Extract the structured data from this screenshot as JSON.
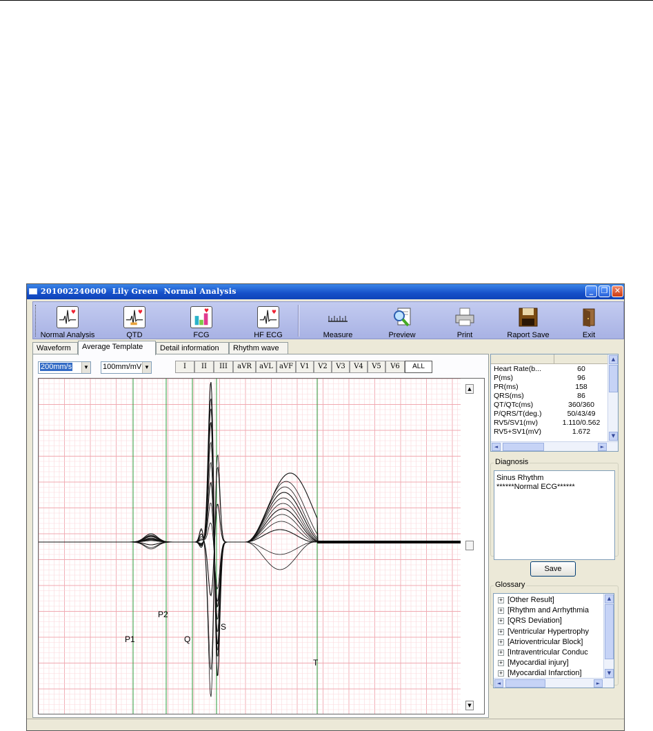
{
  "window": {
    "title": "201002240000  Lily Green  Normal Analysis"
  },
  "toolbar": {
    "items": [
      {
        "label": "Normal Analysis",
        "icon": "ecg-heart-icon"
      },
      {
        "label": "QTD",
        "icon": "ecg-heart-icon"
      },
      {
        "label": "FCG",
        "icon": "fcg-chart-icon"
      },
      {
        "label": "HF ECG",
        "icon": "ecg-heart-icon"
      },
      {
        "label": "Measure",
        "icon": "ruler-icon"
      },
      {
        "label": "Preview",
        "icon": "magnifier-document-icon"
      },
      {
        "label": "Print",
        "icon": "printer-icon"
      },
      {
        "label": "Raport Save",
        "icon": "floppy-disk-icon"
      },
      {
        "label": "Exit",
        "icon": "exit-door-icon"
      }
    ]
  },
  "tabs": [
    "Waveform",
    "Average Template",
    "Detail information",
    "Rhythm wave"
  ],
  "active_tab": "Average Template",
  "controls": {
    "speed": "200mm/s",
    "gain": "100mm/mV",
    "leads": [
      "I",
      "II",
      "III",
      "aVR",
      "aVL",
      "aVF",
      "V1",
      "V2",
      "V3",
      "V4",
      "V5",
      "V6",
      "ALL"
    ],
    "selected_lead": "ALL"
  },
  "markers": [
    "P1",
    "P2",
    "Q",
    "S",
    "T"
  ],
  "parameters": [
    {
      "name": "Heart Rate(b...",
      "value": "60"
    },
    {
      "name": "P(ms)",
      "value": "96"
    },
    {
      "name": "PR(ms)",
      "value": "158"
    },
    {
      "name": "QRS(ms)",
      "value": "86"
    },
    {
      "name": "QT/QTc(ms)",
      "value": "360/360"
    },
    {
      "name": "P/QRS/T(deg.)",
      "value": "50/43/49"
    },
    {
      "name": "RV5/SV1(mv)",
      "value": "1.110/0.562"
    },
    {
      "name": "RV5+SV1(mV)",
      "value": "1.672"
    }
  ],
  "diagnosis": {
    "label": "Diagnosis",
    "text": "Sinus Rhythm\n******Normal ECG******"
  },
  "save_label": "Save",
  "glossary": {
    "label": "Glossary",
    "items": [
      "[Other Result]",
      "[Rhythm and Arrhythmia",
      "[QRS Deviation]",
      "[Ventricular Hypertrophy",
      "[Atrioventricular Block]",
      "[Intraventricular Conduc",
      "[Myocardial injury]",
      "[Myocardial Infarction]"
    ]
  }
}
